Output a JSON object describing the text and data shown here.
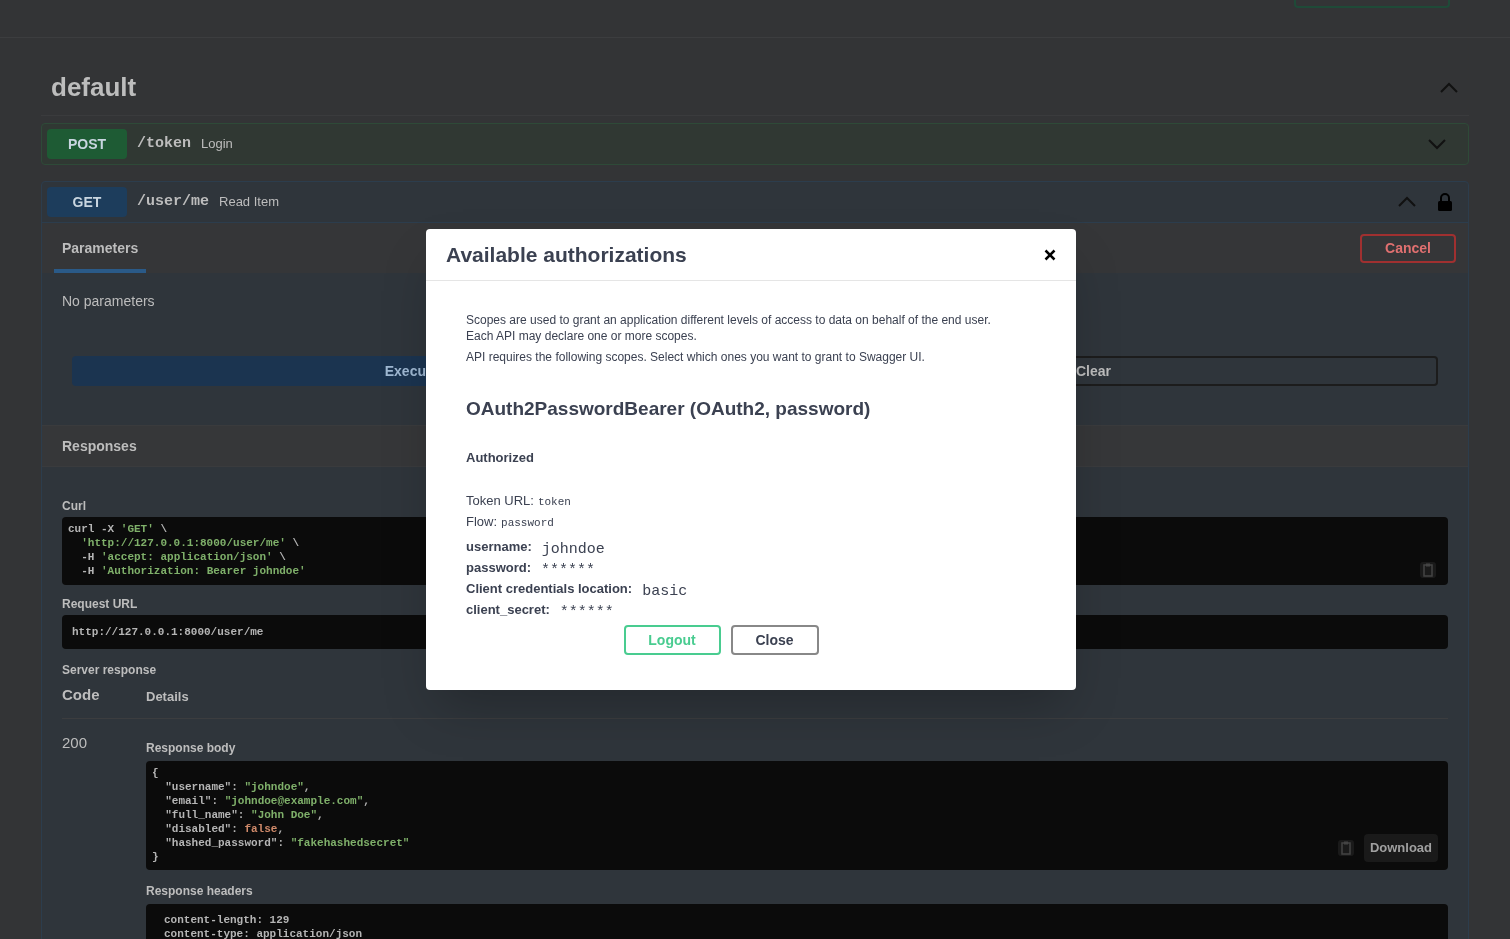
{
  "section": {
    "title": "default",
    "expanded": true
  },
  "operations": [
    {
      "method": "POST",
      "path": "/token",
      "summary": "Login",
      "expanded": false,
      "locked": false,
      "color": "#1e5b34"
    },
    {
      "method": "GET",
      "path": "/user/me",
      "summary": "Read Item",
      "expanded": true,
      "locked": true,
      "color": "#1d3d5c"
    }
  ],
  "panel": {
    "tabs": [
      {
        "label": "Parameters",
        "selected": true
      }
    ],
    "cancel_button": "Cancel",
    "no_params": "No parameters",
    "execute_button": "Execu",
    "clear_button": "Clear",
    "responses_title": "Responses",
    "curl": {
      "label": "Curl",
      "lines": [
        [
          {
            "text": "curl -X ",
            "kind": "plain"
          },
          {
            "text": "'GET'",
            "kind": "string"
          },
          {
            "text": " \\",
            "kind": "plain"
          }
        ],
        [
          {
            "text": "  'http://127.0.0.1:8000/user/me'",
            "kind": "string"
          },
          {
            "text": " \\",
            "kind": "plain"
          }
        ],
        [
          {
            "text": "  -H ",
            "kind": "plain"
          },
          {
            "text": "'accept: application/json'",
            "kind": "string"
          },
          {
            "text": " \\",
            "kind": "plain"
          }
        ],
        [
          {
            "text": "  -H ",
            "kind": "plain"
          },
          {
            "text": "'Authorization: Bearer johndoe'",
            "kind": "string"
          }
        ]
      ]
    },
    "request_url": {
      "label": "Request URL",
      "value": "http://127.0.0.1:8000/user/me"
    },
    "server_response": "Server response",
    "columns": [
      "Code",
      "Details"
    ],
    "code": "200",
    "response_body": {
      "label": "Response body",
      "lines": [
        [
          {
            "text": "{",
            "kind": "plain"
          }
        ],
        [
          {
            "text": "  \"username\": ",
            "kind": "plain"
          },
          {
            "text": "\"johndoe\"",
            "kind": "string"
          },
          {
            "text": ",",
            "kind": "plain"
          }
        ],
        [
          {
            "text": "  \"email\": ",
            "kind": "plain"
          },
          {
            "text": "\"johndoe@example.com\"",
            "kind": "string"
          },
          {
            "text": ",",
            "kind": "plain"
          }
        ],
        [
          {
            "text": "  \"full_name\": ",
            "kind": "plain"
          },
          {
            "text": "\"John Doe\"",
            "kind": "string"
          },
          {
            "text": ",",
            "kind": "plain"
          }
        ],
        [
          {
            "text": "  \"disabled\": ",
            "kind": "plain"
          },
          {
            "text": "false",
            "kind": "literal"
          },
          {
            "text": ",",
            "kind": "plain"
          }
        ],
        [
          {
            "text": "  \"hashed_password\": ",
            "kind": "plain"
          },
          {
            "text": "\"fakehashedsecret\"",
            "kind": "string"
          }
        ],
        [
          {
            "text": "}",
            "kind": "plain"
          }
        ]
      ]
    },
    "download_button": "Download",
    "response_headers": {
      "label": "Response headers",
      "lines": [
        "content-length: 129",
        "content-type: application/json"
      ]
    }
  },
  "modal": {
    "title": "Available authorizations",
    "description_lines": [
      "Scopes are used to grant an application different levels of access to data on behalf of the end user.",
      "Each API may declare one or more scopes."
    ],
    "scopes_note": "API requires the following scopes. Select which ones you want to grant to Swagger UI.",
    "scheme_title": "OAuth2PasswordBearer (OAuth2, password)",
    "status": "Authorized",
    "flow_info": [
      {
        "label": "Token URL:",
        "value": "token"
      },
      {
        "label": "Flow:",
        "value": "password"
      }
    ],
    "credentials": [
      {
        "label": "username:",
        "value": "johndoe"
      },
      {
        "label": "password:",
        "value": "******"
      },
      {
        "label": "Client credentials location:",
        "value": "basic"
      },
      {
        "label": "client_secret:",
        "value": "******"
      }
    ],
    "logout_button": "Logout",
    "close_button": "Close"
  }
}
